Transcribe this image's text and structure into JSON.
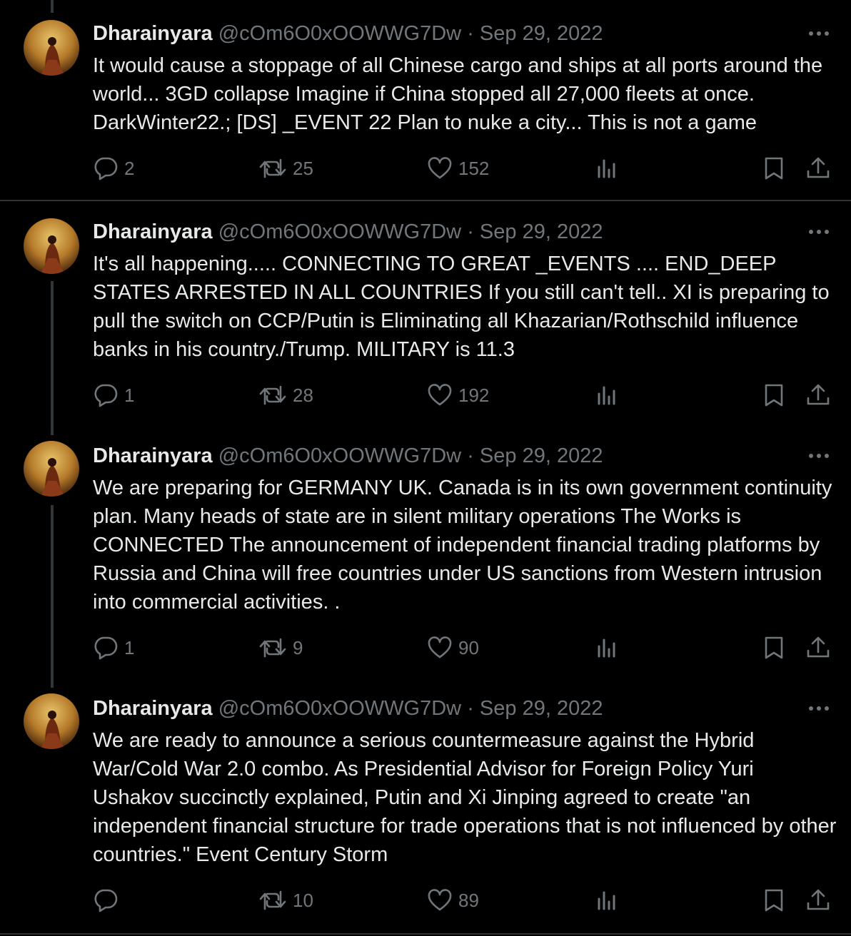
{
  "tweets": [
    {
      "name": "Dharainyara",
      "handle": "@cOm6O0xOOWWG7Dw",
      "separator": "·",
      "date": "Sep 29, 2022",
      "text": "It would cause a stoppage of all Chinese cargo and ships at all ports around the world... 3GD collapse Imagine if China stopped all 27,000 fleets at once. DarkWinter22.; [DS] _EVENT 22 Plan to nuke a city... This is not a game",
      "replies": "2",
      "retweets": "25",
      "likes": "152"
    },
    {
      "name": "Dharainyara",
      "handle": "@cOm6O0xOOWWG7Dw",
      "separator": "·",
      "date": "Sep 29, 2022",
      "text": "It's all happening..... CONNECTING TO GREAT _EVENTS .... END_DEEP STATES ARRESTED IN ALL COUNTRIES If you still can't tell.. XI is preparing to pull the switch on CCP/Putin is Eliminating all Khazarian/Rothschild influence banks in his country./Trump. MILITARY is 11.3",
      "replies": "1",
      "retweets": "28",
      "likes": "192"
    },
    {
      "name": "Dharainyara",
      "handle": "@cOm6O0xOOWWG7Dw",
      "separator": "·",
      "date": "Sep 29, 2022",
      "text": "We are preparing for GERMANY UK. Canada is in its own government continuity plan. Many heads of state are in silent military operations The Works is CONNECTED The announcement of independent financial trading platforms by Russia and China will free countries under US sanctions from Western intrusion into commercial activities. .",
      "replies": "1",
      "retweets": "9",
      "likes": "90"
    },
    {
      "name": "Dharainyara",
      "handle": "@cOm6O0xOOWWG7Dw",
      "separator": "·",
      "date": "Sep 29, 2022",
      "text": "We are ready to announce a serious countermeasure against the Hybrid War/Cold War 2.0 combo. As Presidential Advisor for Foreign Policy Yuri Ushakov succinctly explained, Putin and Xi Jinping agreed to create \"an independent financial structure for trade operations that is not influenced by other countries.\" Event Century Storm",
      "replies": "",
      "retweets": "10",
      "likes": "89"
    }
  ],
  "icons": {
    "reply": "reply-icon",
    "retweet": "retweet-icon",
    "like": "heart-icon",
    "views": "views-chart-icon",
    "bookmark": "bookmark-icon",
    "share": "share-icon",
    "more": "more-icon"
  },
  "colors": {
    "background": "#000000",
    "text": "#e7e9ea",
    "secondary": "#71767b",
    "divider": "#2f3336"
  }
}
